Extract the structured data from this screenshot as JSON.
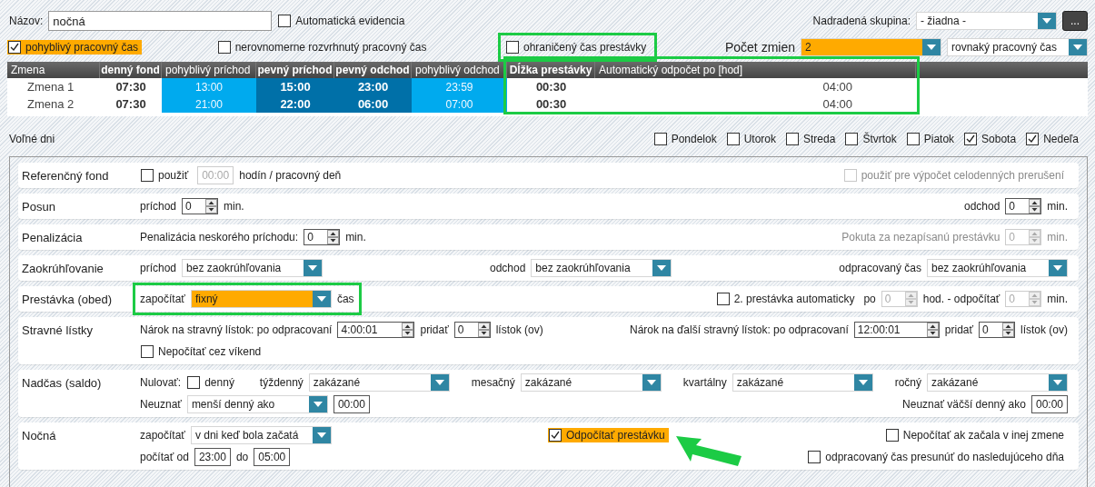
{
  "top": {
    "lines": [
      [
        {
          "kind": "text",
          "text": "Názov:"
        },
        {
          "kind": "input",
          "value": "nočná"
        },
        {
          "kind": "checkbox",
          "label": "Automatická evidencia",
          "checked": false
        },
        {
          "kind": "spacer"
        },
        {
          "kind": "text",
          "text": "Nadradená skupina:"
        },
        {
          "kind": "select",
          "value": "- žiadna -"
        },
        {
          "kind": "button",
          "text": "..."
        }
      ],
      [
        {
          "kind": "checkbox",
          "label": "pohyblivý pracovný čas",
          "checked": true,
          "accent": true
        },
        {
          "kind": "spacer"
        },
        {
          "kind": "checkbox",
          "label": "nerovnomerne rozvrhnutý pracovný čas",
          "checked": false
        },
        {
          "kind": "spacer"
        },
        {
          "kind": "checkbox",
          "label": "ohraničený čas prestávky",
          "checked": false,
          "framed": true
        },
        {
          "kind": "spacer"
        },
        {
          "kind": "title",
          "text": "Počet zmien"
        },
        {
          "kind": "select",
          "value": "2",
          "accent": true
        },
        {
          "kind": "select",
          "value": "rovnaký pracovný čas"
        }
      ]
    ]
  },
  "table": {
    "columns": [
      {
        "label": "Zmena",
        "kind": "name"
      },
      {
        "label": "denný fond",
        "kind": "bold"
      },
      {
        "label": "pohyblivý príchod",
        "kind": "flex"
      },
      {
        "label": "pevný príchod",
        "kind": "fixed"
      },
      {
        "label": "pevný odchod",
        "kind": "fixed"
      },
      {
        "label": "pohyblivý odchod",
        "kind": "flex"
      },
      {
        "label": "Dĺžka prestávky",
        "kind": "bold",
        "highlighted": true
      },
      {
        "label": "Automatický odpočet po [hod]",
        "kind": "plain",
        "highlighted": true
      }
    ],
    "rows": [
      [
        "Zmena 1",
        "07:30",
        "13:00",
        "15:00",
        "23:00",
        "23:59",
        "00:30",
        "04:00"
      ],
      [
        "Zmena 2",
        "07:30",
        "21:00",
        "22:00",
        "06:00",
        "07:00",
        "00:30",
        "04:00"
      ]
    ]
  },
  "days": [
    {
      "kind": "text",
      "text": "Voľné dni"
    },
    {
      "kind": "spacer"
    },
    {
      "kind": "checkbox",
      "label": "Pondelok",
      "checked": false
    },
    {
      "kind": "checkbox",
      "label": "Utorok",
      "checked": false
    },
    {
      "kind": "checkbox",
      "label": "Streda",
      "checked": false
    },
    {
      "kind": "checkbox",
      "label": "Štvrtok",
      "checked": false
    },
    {
      "kind": "checkbox",
      "label": "Piatok",
      "checked": false
    },
    {
      "kind": "checkbox",
      "label": "Sobota",
      "checked": true
    },
    {
      "kind": "checkbox",
      "label": "Nedeľa",
      "checked": true
    }
  ],
  "sections": [
    {
      "title": "Referenčný fond",
      "lines": [
        [
          {
            "kind": "checkbox",
            "label": "použiť",
            "checked": false
          },
          {
            "kind": "time",
            "value": "00:00",
            "disabled": true
          },
          {
            "kind": "text",
            "text": "hodín / pracovný deň"
          },
          {
            "kind": "spacer"
          },
          {
            "kind": "checkbox",
            "label": "použiť pre výpočet celodenných prerušení",
            "checked": false,
            "disabled": true
          }
        ]
      ]
    },
    {
      "title": "Posun",
      "lines": [
        [
          {
            "kind": "text",
            "text": "príchod"
          },
          {
            "kind": "spin",
            "value": "0"
          },
          {
            "kind": "text",
            "text": "min."
          },
          {
            "kind": "spacer"
          },
          {
            "kind": "text",
            "text": "odchod"
          },
          {
            "kind": "spin",
            "value": "0"
          },
          {
            "kind": "text",
            "text": "min."
          }
        ]
      ]
    },
    {
      "title": "Penalizácia",
      "lines": [
        [
          {
            "kind": "text",
            "text": "Penalizácia neskorého príchodu:"
          },
          {
            "kind": "spin",
            "value": "0"
          },
          {
            "kind": "text",
            "text": "min."
          },
          {
            "kind": "spacer"
          },
          {
            "kind": "text",
            "text": "Pokuta za nezapísanú prestávku",
            "disabled": true
          },
          {
            "kind": "spin",
            "value": "0",
            "disabled": true
          },
          {
            "kind": "text",
            "text": "min.",
            "disabled": true
          }
        ]
      ]
    },
    {
      "title": "Zaokrúhľovanie",
      "lines": [
        [
          {
            "kind": "text",
            "text": "príchod"
          },
          {
            "kind": "select",
            "value": "bez zaokrúhľovania"
          },
          {
            "kind": "spacer"
          },
          {
            "kind": "text",
            "text": "odchod"
          },
          {
            "kind": "select",
            "value": "bez zaokrúhľovania"
          },
          {
            "kind": "spacer"
          },
          {
            "kind": "text",
            "text": "odpracovaný čas"
          },
          {
            "kind": "select",
            "value": "bez zaokrúhľovania"
          }
        ]
      ]
    },
    {
      "title": "Prestávka (obed)",
      "lines": [
        [
          {
            "kind": "group",
            "framed": true,
            "items": [
              {
                "kind": "text",
                "text": "započítať"
              },
              {
                "kind": "select",
                "value": "fixný",
                "accent": true
              },
              {
                "kind": "text",
                "text": "čas"
              }
            ]
          },
          {
            "kind": "spacer"
          },
          {
            "kind": "checkbox",
            "label": "2. prestávka automaticky",
            "checked": false
          },
          {
            "kind": "text",
            "text": "po"
          },
          {
            "kind": "spin",
            "value": "0",
            "disabled": true
          },
          {
            "kind": "text",
            "text": "hod. - odpočítať"
          },
          {
            "kind": "spin",
            "value": "0",
            "disabled": true
          },
          {
            "kind": "text",
            "text": "min."
          }
        ]
      ]
    },
    {
      "title": "Stravné lístky",
      "lines": [
        [
          {
            "kind": "text",
            "text": "Nárok na stravný lístok: po odpracovaní"
          },
          {
            "kind": "spin",
            "value": "4:00:01"
          },
          {
            "kind": "text",
            "text": "pridať"
          },
          {
            "kind": "spin",
            "value": "0"
          },
          {
            "kind": "text",
            "text": "lístok (ov)"
          },
          {
            "kind": "spacer"
          },
          {
            "kind": "text",
            "text": "Nárok na ďalší stravný lístok: po odpracovaní"
          },
          {
            "kind": "spin",
            "value": "12:00:01"
          },
          {
            "kind": "text",
            "text": "pridať"
          },
          {
            "kind": "spin",
            "value": "0"
          },
          {
            "kind": "text",
            "text": "lístok (ov)"
          }
        ],
        [
          {
            "kind": "checkbox",
            "label": "Nepočítať cez víkend",
            "checked": false
          }
        ]
      ]
    },
    {
      "title": "Nadčas (saldo)",
      "lines": [
        [
          {
            "kind": "text",
            "text": "Nulovať:"
          },
          {
            "kind": "checkbox",
            "label": "denný",
            "checked": false
          },
          {
            "kind": "spacer"
          },
          {
            "kind": "text",
            "text": "týždenný"
          },
          {
            "kind": "select",
            "value": "zakázané"
          },
          {
            "kind": "spacer"
          },
          {
            "kind": "text",
            "text": "mesačný"
          },
          {
            "kind": "select",
            "value": "zakázané"
          },
          {
            "kind": "spacer"
          },
          {
            "kind": "text",
            "text": "kvartálny"
          },
          {
            "kind": "select",
            "value": "zakázané"
          },
          {
            "kind": "spacer"
          },
          {
            "kind": "text",
            "text": "ročný"
          },
          {
            "kind": "select",
            "value": "zakázané"
          }
        ],
        [
          {
            "kind": "text",
            "text": "Neuznať"
          },
          {
            "kind": "select",
            "value": "menší denný ako"
          },
          {
            "kind": "time",
            "value": "00:00"
          },
          {
            "kind": "spacer"
          },
          {
            "kind": "text",
            "text": "Neuznať väčší denný ako"
          },
          {
            "kind": "time",
            "value": "00:00"
          }
        ]
      ]
    },
    {
      "title": "Nočná",
      "lines": [
        [
          {
            "kind": "text",
            "text": "započítať"
          },
          {
            "kind": "select",
            "value": "v dni keď bola začatá"
          },
          {
            "kind": "spacer"
          },
          {
            "kind": "checkbox",
            "label": "Odpočítať prestávku",
            "checked": true,
            "accent": true,
            "pointed": true
          },
          {
            "kind": "spacer"
          },
          {
            "kind": "checkbox",
            "label": "Nepočítať ak začala v inej zmene",
            "checked": false
          }
        ],
        [
          {
            "kind": "text",
            "text": "počítať od"
          },
          {
            "kind": "time",
            "value": "23:00"
          },
          {
            "kind": "text",
            "text": "do"
          },
          {
            "kind": "time",
            "value": "05:00"
          },
          {
            "kind": "spacer"
          },
          {
            "kind": "checkbox",
            "label": "odpracovaný čas presunúť do nasledujúceho dňa",
            "checked": false
          }
        ]
      ]
    }
  ]
}
